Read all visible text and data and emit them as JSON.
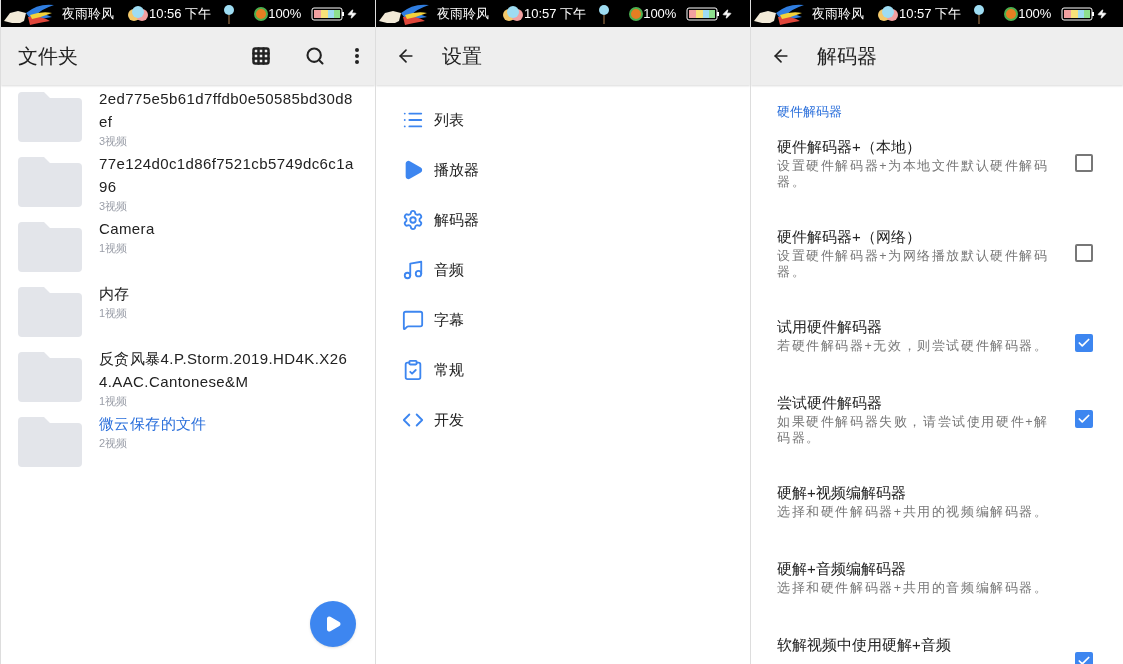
{
  "panels": [
    {
      "kind": "folders",
      "status": {
        "carrier": "夜雨聆风",
        "time": "10:56 下午",
        "battery": "100%"
      },
      "title": "文件夹",
      "folders": [
        {
          "name": "2ed775e5b61d7ffdb0e50585bd30d8ef",
          "count": "3视频",
          "highlighted": false
        },
        {
          "name": "77e124d0c1d86f7521cb5749dc6c1a96",
          "count": "3视频",
          "highlighted": false
        },
        {
          "name": "Camera",
          "count": "1视频",
          "highlighted": false
        },
        {
          "name": "内存",
          "count": "1视频",
          "highlighted": false
        },
        {
          "name": "反贪风暴4.P.Storm.2019.HD4K.X264.AAC.Cantonese&M",
          "count": "1视频",
          "highlighted": false
        },
        {
          "name": "微云保存的文件",
          "count": "2视频",
          "highlighted": true
        }
      ]
    },
    {
      "kind": "settings",
      "status": {
        "carrier": "夜雨聆风",
        "time": "10:57 下午",
        "battery": "100%"
      },
      "title": "设置",
      "items": [
        "列表",
        "播放器",
        "解码器",
        "音频",
        "字幕",
        "常规",
        "开发"
      ]
    },
    {
      "kind": "decoder",
      "status": {
        "carrier": "夜雨聆风",
        "time": "10:57 下午",
        "battery": "100%"
      },
      "title": "解码器",
      "section": "硬件解码器",
      "rows": [
        {
          "kind": "checkbox",
          "title": "硬件解码器+（本地）",
          "desc": "设置硬件解码器+为本地文件默认硬件解码器。",
          "checked": false
        },
        {
          "kind": "checkbox",
          "title": "硬件解码器+（网络）",
          "desc": "设置硬件解码器+为网络播放默认硬件解码器。",
          "checked": false
        },
        {
          "kind": "checkbox",
          "title": "试用硬件解码器",
          "desc": "若硬件解码器+无效，则尝试硬件解码器。",
          "checked": true
        },
        {
          "kind": "checkbox",
          "title": "尝试硬件解码器",
          "desc": "如果硬件解码器失败，请尝试使用硬件+解码器。",
          "checked": true
        },
        {
          "kind": "plain",
          "title": "硬解+视频编解码器",
          "desc": "选择和硬件解码器+共用的视频编解码器。"
        },
        {
          "kind": "plain",
          "title": "硬解+音频编解码器",
          "desc": "选择和硬件解码器+共用的音频编解码器。"
        },
        {
          "kind": "checkbox",
          "title": "软解视频中使用硬解+音频",
          "checked": true
        }
      ]
    }
  ]
}
